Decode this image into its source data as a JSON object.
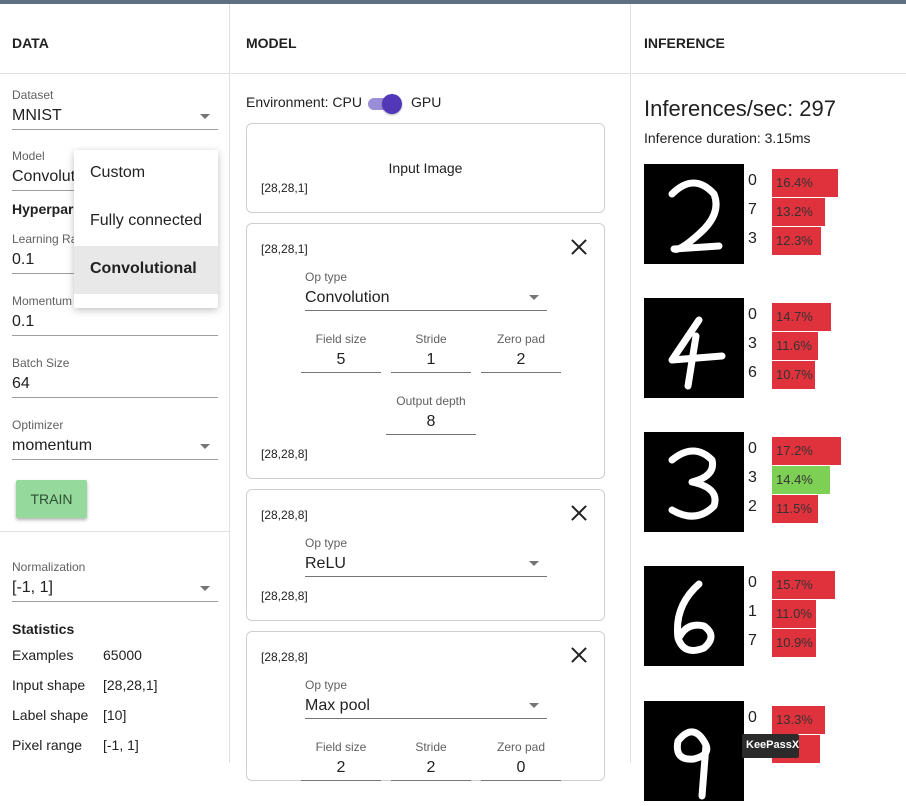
{
  "data_col": {
    "header": "DATA",
    "dataset": {
      "label": "Dataset",
      "value": "MNIST"
    },
    "model": {
      "label": "Model",
      "value": "Convolut"
    },
    "hyper_title": "Hyperpar",
    "learning_rate": {
      "label": "Learning Ra",
      "value": "0.1"
    },
    "momentum": {
      "label": "Momentum",
      "value": "0.1"
    },
    "batch_size": {
      "label": "Batch Size",
      "value": "64"
    },
    "optimizer": {
      "label": "Optimizer",
      "value": "momentum"
    },
    "train_label": "TRAIN",
    "normalization": {
      "label": "Normalization",
      "value": "[-1, 1]"
    },
    "stats_title": "Statistics",
    "stats": [
      {
        "key": "Examples",
        "value": "65000"
      },
      {
        "key": "Input shape",
        "value": "[28,28,1]"
      },
      {
        "key": "Label shape",
        "value": "[10]"
      },
      {
        "key": "Pixel range",
        "value": "[-1, 1]"
      }
    ],
    "model_menu": [
      "Custom",
      "Fully connected",
      "Convolutional"
    ]
  },
  "model_col": {
    "header": "MODEL",
    "environment_label": "Environment: CPU",
    "gpu_label": "GPU",
    "input_card": {
      "title": "Input Image",
      "shape": "[28,28,1]"
    },
    "layers": [
      {
        "in_shape": "[28,28,1]",
        "op_label": "Op type",
        "op_value": "Convolution",
        "params": [
          {
            "label": "Field size",
            "value": "5"
          },
          {
            "label": "Stride",
            "value": "1"
          },
          {
            "label": "Zero pad",
            "value": "2"
          },
          {
            "label": "Output depth",
            "value": "8"
          }
        ],
        "out_shape": "[28,28,8]"
      },
      {
        "in_shape": "[28,28,8]",
        "op_label": "Op type",
        "op_value": "ReLU",
        "out_shape": "[28,28,8]"
      },
      {
        "in_shape": "[28,28,8]",
        "op_label": "Op type",
        "op_value": "Max pool",
        "params": [
          {
            "label": "Field size",
            "value": "2"
          },
          {
            "label": "Stride",
            "value": "2"
          },
          {
            "label": "Zero pad",
            "value": "0"
          }
        ]
      }
    ]
  },
  "inference_col": {
    "header": "INFERENCE",
    "per_sec": "Inferences/sec: 297",
    "duration": "Inference duration: 3.15ms",
    "samples": [
      {
        "digit": "2",
        "preds": [
          {
            "label": "0",
            "pct": "16.4%",
            "frac": 0.164,
            "color": "#e0323c"
          },
          {
            "label": "7",
            "pct": "13.2%",
            "frac": 0.132,
            "color": "#e0323c"
          },
          {
            "label": "3",
            "pct": "12.3%",
            "frac": 0.123,
            "color": "#e0323c"
          }
        ]
      },
      {
        "digit": "4",
        "preds": [
          {
            "label": "0",
            "pct": "14.7%",
            "frac": 0.147,
            "color": "#e0323c"
          },
          {
            "label": "3",
            "pct": "11.6%",
            "frac": 0.116,
            "color": "#e0323c"
          },
          {
            "label": "6",
            "pct": "10.7%",
            "frac": 0.107,
            "color": "#e0323c"
          }
        ]
      },
      {
        "digit": "3",
        "preds": [
          {
            "label": "0",
            "pct": "17.2%",
            "frac": 0.172,
            "color": "#e0323c"
          },
          {
            "label": "3",
            "pct": "14.4%",
            "frac": 0.144,
            "color": "#7ed054"
          },
          {
            "label": "2",
            "pct": "11.5%",
            "frac": 0.115,
            "color": "#e0323c"
          }
        ]
      },
      {
        "digit": "6",
        "preds": [
          {
            "label": "0",
            "pct": "15.7%",
            "frac": 0.157,
            "color": "#e0323c"
          },
          {
            "label": "1",
            "pct": "11.0%",
            "frac": 0.11,
            "color": "#e0323c"
          },
          {
            "label": "7",
            "pct": "10.9%",
            "frac": 0.109,
            "color": "#e0323c"
          }
        ]
      },
      {
        "digit": "9",
        "preds": [
          {
            "label": "0",
            "pct": "13.3%",
            "frac": 0.133,
            "color": "#e0323c"
          },
          {
            "label": "",
            "pct": "8%",
            "frac": 0.12,
            "color": "#e0323c"
          }
        ]
      }
    ]
  },
  "keepass_label": "KeePassX"
}
